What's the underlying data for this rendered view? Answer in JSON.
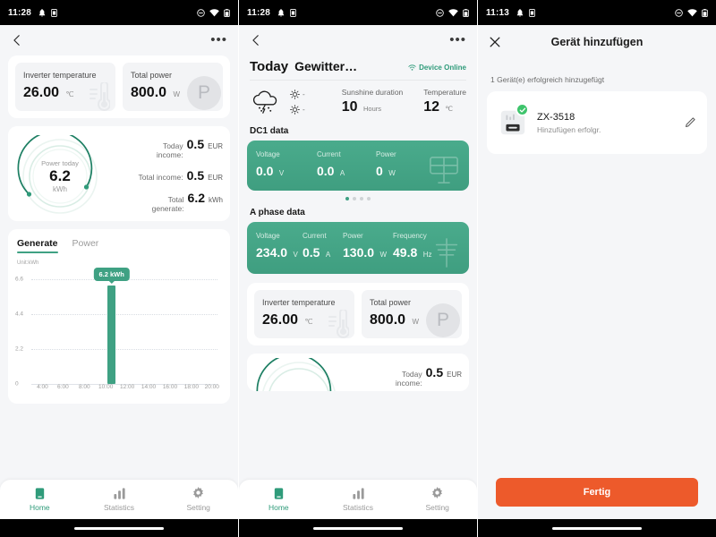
{
  "colors": {
    "green": "#3fa183",
    "green_dark": "#1d7f63",
    "green_light": "#bfe3d6",
    "orange": "#ed5a2b",
    "check_green": "#3ec46c",
    "bg": "#f5f6f8"
  },
  "panel1": {
    "statusbar": {
      "time": "11:28",
      "icons": [
        "bell-icon",
        "sim-card-icon",
        "dnd-icon",
        "wifi-icon",
        "battery-icon"
      ]
    },
    "appbar": {
      "back": "back-chevron-icon",
      "overflow": "more-options-icon"
    },
    "stats": [
      {
        "label": "Inverter temperature",
        "value": "26.00",
        "unit": "℃",
        "icon": "thermometer-icon"
      },
      {
        "label": "Total power",
        "value": "800.0",
        "unit": "W",
        "icon": "power-p-icon"
      }
    ],
    "gauge": {
      "label": "Power today",
      "value": "6.2",
      "unit": "kWh",
      "percent": 72
    },
    "income": [
      {
        "label": "Today income:",
        "value": "0.5",
        "unit": "EUR"
      },
      {
        "label": "Total income:",
        "value": "0.5",
        "unit": "EUR"
      },
      {
        "label": "Total generate:",
        "value": "6.2",
        "unit": "kWh"
      }
    ],
    "tabs": [
      {
        "label": "Generate",
        "active": true
      },
      {
        "label": "Power",
        "active": false
      }
    ],
    "chart_unit": "Unit:kWh",
    "nav": [
      {
        "label": "Home",
        "icon": "home-icon",
        "active": true
      },
      {
        "label": "Statistics",
        "icon": "bar-chart-icon",
        "active": false
      },
      {
        "label": "Setting",
        "icon": "gear-icon",
        "active": false
      }
    ]
  },
  "chart_data": {
    "type": "bar",
    "title": "",
    "xlabel": "",
    "ylabel": "Unit:kWh",
    "categories": [
      "4:00",
      "6:00",
      "8:00",
      "10:00",
      "12:00",
      "14:00",
      "16:00",
      "18:00",
      "20:00"
    ],
    "yticks": [
      "0",
      "2.2",
      "4.4",
      "6.6"
    ],
    "ylim": [
      0,
      7.33
    ],
    "grid": true,
    "bars": [
      {
        "x": "11:00",
        "value": 6.2,
        "label": "6.2 kWh",
        "color": "#3fa183"
      }
    ],
    "annotation": "6.2 kWh"
  },
  "panel2": {
    "statusbar": {
      "time": "11:28"
    },
    "today": {
      "word": "Today",
      "weather": "Gewitter…",
      "status": "Device Online",
      "status_icon": "wifi-icon"
    },
    "weather": {
      "icon": "thunderstorm-cloud-icon",
      "sun_rows": [
        {
          "icon": "sun-icon",
          "value": "-"
        },
        {
          "icon": "sun-icon",
          "value": "-"
        }
      ],
      "metrics": [
        {
          "label": "Sunshine duration",
          "value": "10",
          "unit": "Hours"
        },
        {
          "label": "Temperature",
          "value": "12",
          "unit": "℃"
        }
      ]
    },
    "dc1": {
      "title": "DC1 data",
      "icon": "solar-panel-icon",
      "fields": [
        {
          "label": "Voltage",
          "value": "0.0",
          "unit": "V"
        },
        {
          "label": "Current",
          "value": "0.0",
          "unit": "A"
        },
        {
          "label": "Power",
          "value": "0",
          "unit": "W"
        }
      ],
      "dots": 4,
      "active_dot": 0
    },
    "aphase": {
      "title": "A phase data",
      "icon": "power-pole-icon",
      "fields": [
        {
          "label": "Voltage",
          "value": "234.0",
          "unit": "V"
        },
        {
          "label": "Current",
          "value": "0.5",
          "unit": "A"
        },
        {
          "label": "Power",
          "value": "130.0",
          "unit": "W"
        },
        {
          "label": "Frequency",
          "value": "49.8",
          "unit": "Hz"
        }
      ]
    },
    "stats": [
      {
        "label": "Inverter temperature",
        "value": "26.00",
        "unit": "℃",
        "icon": "thermometer-icon"
      },
      {
        "label": "Total power",
        "value": "800.0",
        "unit": "W",
        "icon": "power-p-icon"
      }
    ],
    "income_peek": {
      "label": "Today income:",
      "value": "0.5",
      "unit": "EUR"
    },
    "nav": [
      {
        "label": "Home",
        "icon": "home-icon",
        "active": true
      },
      {
        "label": "Statistics",
        "icon": "bar-chart-icon",
        "active": false
      },
      {
        "label": "Setting",
        "icon": "gear-icon",
        "active": false
      }
    ]
  },
  "panel3": {
    "statusbar": {
      "time": "11:13"
    },
    "appbar": {
      "close": "close-icon",
      "title": "Gerät hinzufügen"
    },
    "subtitle": "1 Gerät(e) erfolgreich hinzugefügt",
    "device": {
      "name": "ZX-3518",
      "state": "Hinzufügen erfolgr.",
      "icon": "device-plug-icon",
      "badge": "check-icon",
      "edit": "pencil-icon"
    },
    "done_button": "Fertig"
  }
}
